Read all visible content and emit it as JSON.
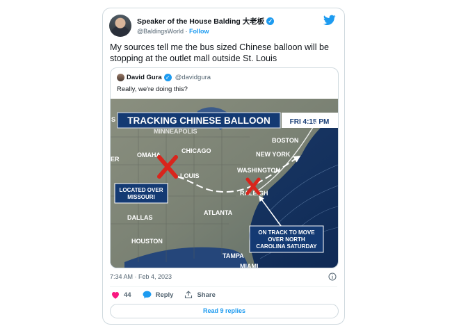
{
  "tweet": {
    "author_name": "Speaker of the House Balding 大老板",
    "handle": "@BaldingsWorld",
    "separator": "·",
    "follow_label": "Follow",
    "text": "My sources tell me the bus sized Chinese balloon will be stopping at the outlet mall outside St. Louis",
    "timestamp": "7:34 AM · Feb 4, 2023",
    "likes": "44",
    "reply_label": "Reply",
    "share_label": "Share",
    "read_replies_label": "Read 9 replies"
  },
  "quoted": {
    "author_name": "David Gura",
    "handle": "@davidgura",
    "text": "Really, we're doing this?",
    "map": {
      "headline": "TRACKING CHINESE BALLOON",
      "time_badge": "FRI 4:15 PM",
      "edge_s": "S",
      "edge_er": "ER",
      "cities": {
        "minneapolis": "MINNEAPOLIS",
        "omaha": "OMAHA",
        "chicago": "CHICAGO",
        "boston": "BOSTON",
        "new_york": "NEW YORK",
        "washington": "WASHINGTON",
        "st_louis": "LOUIS",
        "raleigh": "RALEIGH",
        "atlanta": "ATLANTA",
        "dallas": "DALLAS",
        "houston": "HOUSTON",
        "tampa": "TAMPA",
        "miami": "MIAMI"
      },
      "callout_left": [
        "LOCATED OVER",
        "MISSOURI"
      ],
      "callout_right": [
        "ON TRACK TO MOVE",
        "OVER NORTH",
        "CAROLINA SATURDAY"
      ]
    }
  },
  "colors": {
    "accent": "#1d9bf0",
    "like": "#f91880",
    "map_banner": "#143a73",
    "marker_red": "#d9251c"
  }
}
